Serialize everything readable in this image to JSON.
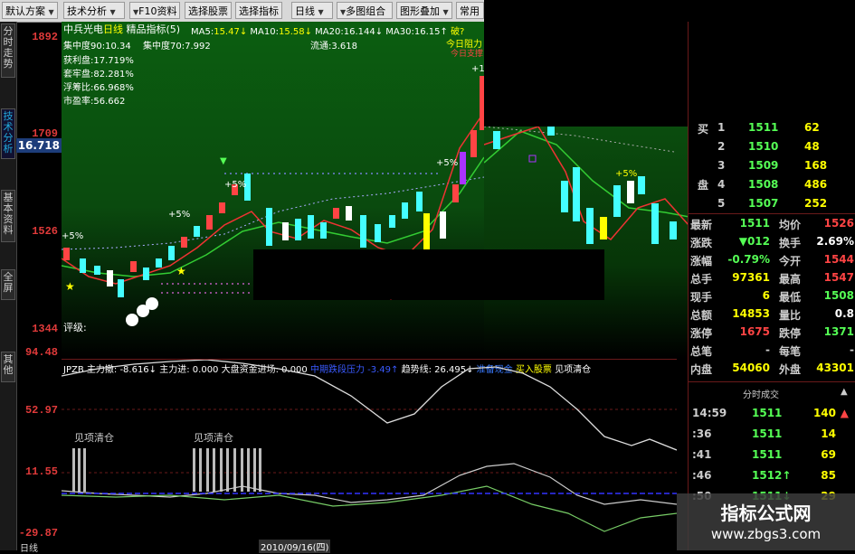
{
  "toolbar": {
    "buttons": [
      "默认方案",
      "技术分析",
      "F10资料",
      "选择股票",
      "选择指标",
      "日线",
      "多图组合",
      "图形叠加",
      "常用"
    ]
  },
  "left_tabs": [
    "分时走势",
    "技术分析",
    "基本资料",
    "全屏",
    "其他"
  ],
  "left_tab_active": 1,
  "y_axis": {
    "labels": [
      "1892",
      "1709",
      "1526",
      "1344"
    ],
    "price_box": "16.718"
  },
  "main_chart": {
    "stock": "中兵光电",
    "period": "日线",
    "indicator": "精品指标(5)",
    "ma_labels": [
      "MA5:",
      "15.47↓",
      "MA10:",
      "15.58↓",
      "MA20:",
      "16.144↓",
      "MA30:",
      "16.15↑"
    ],
    "ma_extra": "破?",
    "concentration_1": "集中度90:10.34",
    "concentration_2": "集中度70:7.992",
    "float_text": "流通:3.618",
    "stats": [
      "获利盘:17.719%",
      "套牢盘:82.281%",
      "浮筹比:66.968%",
      "市盈率:56.662"
    ],
    "marker_right": "今日阻力",
    "marker_right2": "今日支撑",
    "pct_marks": [
      "+5%",
      "+5%",
      "+5%",
      "+5%",
      "+1"
    ],
    "rating": "评级:"
  },
  "indicator_panel": {
    "name": "JPZB",
    "values": [
      {
        "text": "主力撤: -8.616↓",
        "color": "#ffffff"
      },
      {
        "text": "主力进: 0.000",
        "color": "#ffffff"
      },
      {
        "text": "大盘资金进场: 0.000",
        "color": "#ffffff"
      },
      {
        "text": "中期跌段压力",
        "color": "#3a5aff"
      },
      {
        "text": "-3.49↑",
        "color": "#3a5aff"
      },
      {
        "text": "趋势线: 26.495↓",
        "color": "#ffffff"
      },
      {
        "text": "准备现金",
        "color": "#3a7aff"
      },
      {
        "text": "买入股票",
        "color": "#ffff00"
      },
      {
        "text": "见项清仓",
        "color": "#ffffff"
      }
    ],
    "axis": [
      "94.48",
      "52.97",
      "11.55",
      "-29.87"
    ],
    "bar_label_1": "见项清仓",
    "bar_label_2": "见项清仓",
    "date_label": "2010/09/16(四)",
    "bottom_left": "日线"
  },
  "order_book": {
    "side_buy": "买",
    "side_plate": "盘",
    "levels": [
      {
        "n": "1",
        "price": "1511",
        "vol": "62"
      },
      {
        "n": "2",
        "price": "1510",
        "vol": "48"
      },
      {
        "n": "3",
        "price": "1509",
        "vol": "168"
      },
      {
        "n": "4",
        "price": "1508",
        "vol": "486"
      },
      {
        "n": "5",
        "price": "1507",
        "vol": "252"
      }
    ]
  },
  "quote": [
    {
      "l1": "最新",
      "v1": "1511",
      "l2": "均价",
      "v2": "1526"
    },
    {
      "l1": "涨跌",
      "v1": "▼012",
      "l2": "换手",
      "v2": "2.69%"
    },
    {
      "l1": "涨幅",
      "v1": "-0.79%",
      "l2": "今开",
      "v2": "1544"
    },
    {
      "l1": "总手",
      "v1": "97361",
      "l2": "最高",
      "v2": "1547"
    },
    {
      "l1": "现手",
      "v1": "6",
      "l2": "最低",
      "v2": "1508"
    },
    {
      "l1": "总额",
      "v1": "14853",
      "l2": "量比",
      "v2": "0.8"
    },
    {
      "l1": "涨停",
      "v1": "1675",
      "l2": "跌停",
      "v2": "1371"
    },
    {
      "l1": "总笔",
      "v1": "-",
      "l2": "每笔",
      "v2": "-"
    },
    {
      "l1": "内盘",
      "v1": "54060",
      "l2": "外盘",
      "v2": "43301"
    }
  ],
  "ticks": {
    "header": "分时成交",
    "rows": [
      {
        "t": "14:59",
        "p": "1511",
        "v": "140",
        "arrow": "▲"
      },
      {
        "t": ":36",
        "p": "1511",
        "v": "14",
        "arrow": ""
      },
      {
        "t": ":41",
        "p": "1511",
        "v": "69",
        "arrow": ""
      },
      {
        "t": ":46",
        "p": "1512↑",
        "v": "85",
        "arrow": ""
      },
      {
        "t": ":50",
        "p": "1511↓",
        "v": "29",
        "arrow": ""
      }
    ]
  },
  "watermark": {
    "line1": "指标公式网",
    "line2": "www.zbgs3.com"
  },
  "colors": {
    "up": "#ff3c3c",
    "down": "#4ff",
    "accent": "#ffff00",
    "panel_border": "#6a1a1a"
  }
}
